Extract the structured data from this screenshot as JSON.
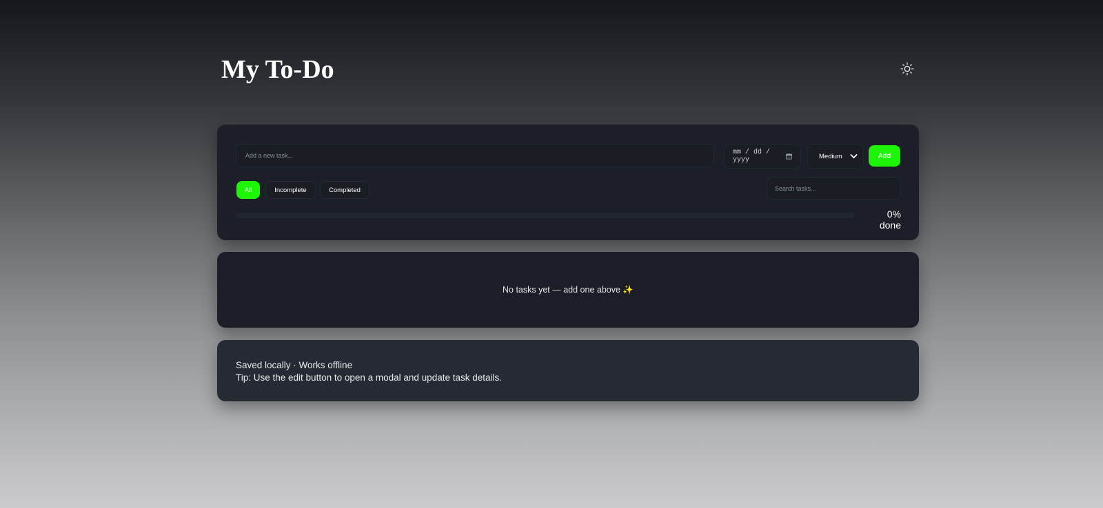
{
  "app": {
    "title": "My To-Do",
    "theme_toggle_icon": "sun-icon"
  },
  "composer": {
    "task_placeholder": "Add a new task...",
    "date_placeholder": "mm / dd / yyyy",
    "priority_selected": "Medium",
    "add_label": "Add"
  },
  "filters": {
    "items": [
      {
        "label": "All",
        "active": true
      },
      {
        "label": "Incomplete",
        "active": false
      },
      {
        "label": "Completed",
        "active": false
      }
    ],
    "search_placeholder": "Search tasks..."
  },
  "progress": {
    "percent": 0,
    "label": "0% done"
  },
  "tasks": {
    "empty_message": "No tasks yet — add one above ✨"
  },
  "footer": {
    "line1": "Saved locally · Works offline",
    "line2": "Tip: Use the edit button to open a modal and update task details."
  },
  "colors": {
    "accent": "#1ef407",
    "card": "#1c1f27"
  }
}
